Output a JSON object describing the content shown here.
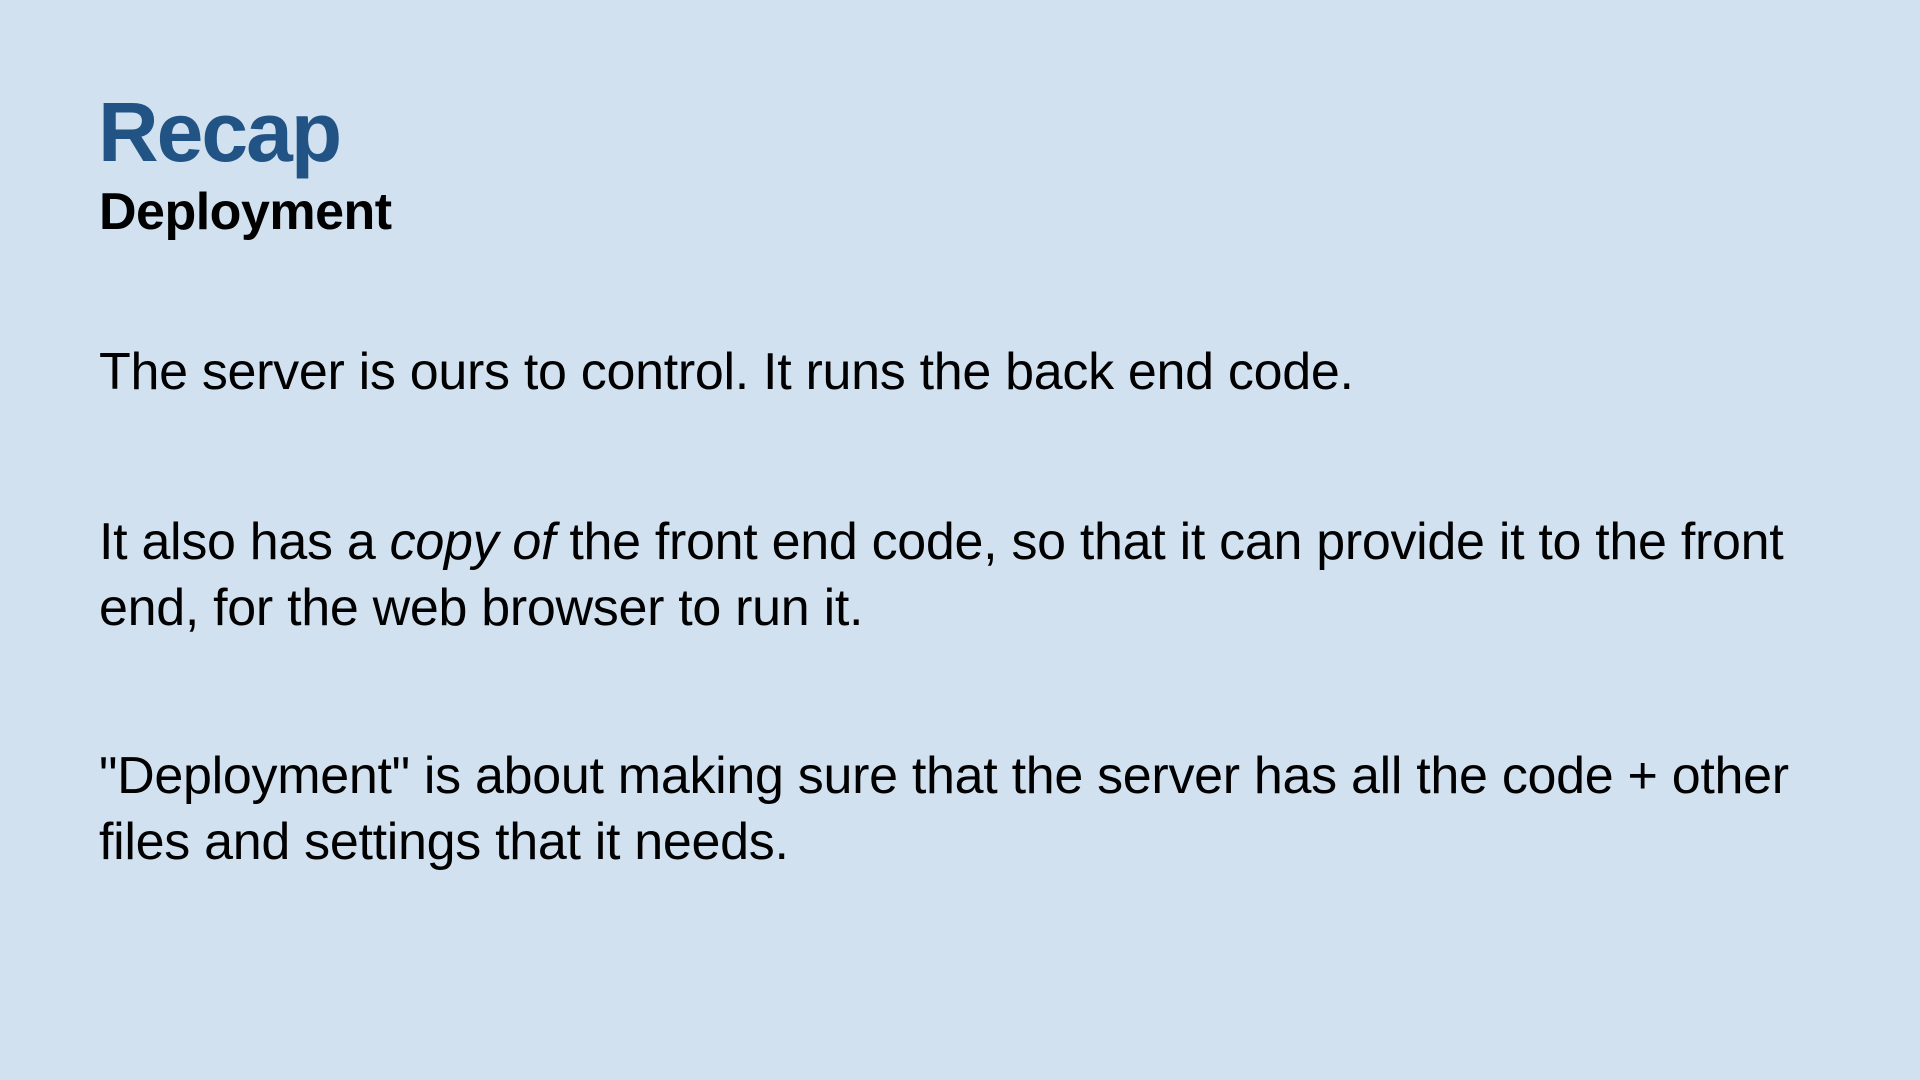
{
  "slide": {
    "title": "Recap",
    "subtitle": "Deployment",
    "paragraph1": "The server is ours to control. It runs the back end code.",
    "paragraph2": {
      "before": "It also has a ",
      "emphasis": "copy of",
      "after": " the front end code, so that it can provide it to the front end, for the web browser to run it."
    },
    "paragraph3": "\"Deployment\" is about making sure that the server has all the code + other files and settings that it needs."
  },
  "colors": {
    "background": "#d1e1f0",
    "title": "#215485",
    "text": "#000000"
  }
}
